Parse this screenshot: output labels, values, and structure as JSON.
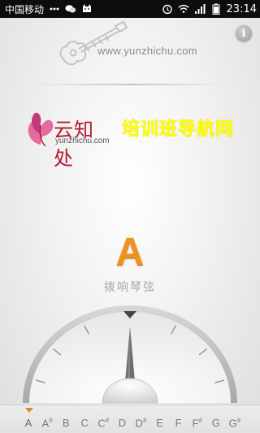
{
  "status_bar": {
    "carrier": "中国移动",
    "time": "23:14",
    "battery_level": 0.9
  },
  "header": {
    "url": "www.yunzhichu.com",
    "info_label": "i"
  },
  "logo": {
    "chinese": "云知处",
    "english": "yunzhichu.com"
  },
  "banner": {
    "text": "培训班导航网",
    "color": "#ffff00"
  },
  "tuner": {
    "note": "A",
    "hint": "拨响琴弦",
    "accent_color": "#f0921e",
    "needle_deviation": 0
  },
  "strings": [
    {
      "name": "A",
      "sharp": ""
    },
    {
      "name": "A",
      "sharp": "#"
    },
    {
      "name": "B",
      "sharp": ""
    },
    {
      "name": "C",
      "sharp": ""
    },
    {
      "name": "C",
      "sharp": "#"
    },
    {
      "name": "D",
      "sharp": ""
    },
    {
      "name": "D",
      "sharp": "#"
    },
    {
      "name": "E",
      "sharp": ""
    },
    {
      "name": "F",
      "sharp": ""
    },
    {
      "name": "F",
      "sharp": "#"
    },
    {
      "name": "G",
      "sharp": ""
    },
    {
      "name": "G",
      "sharp": "#"
    }
  ],
  "selected_string_index": 0
}
